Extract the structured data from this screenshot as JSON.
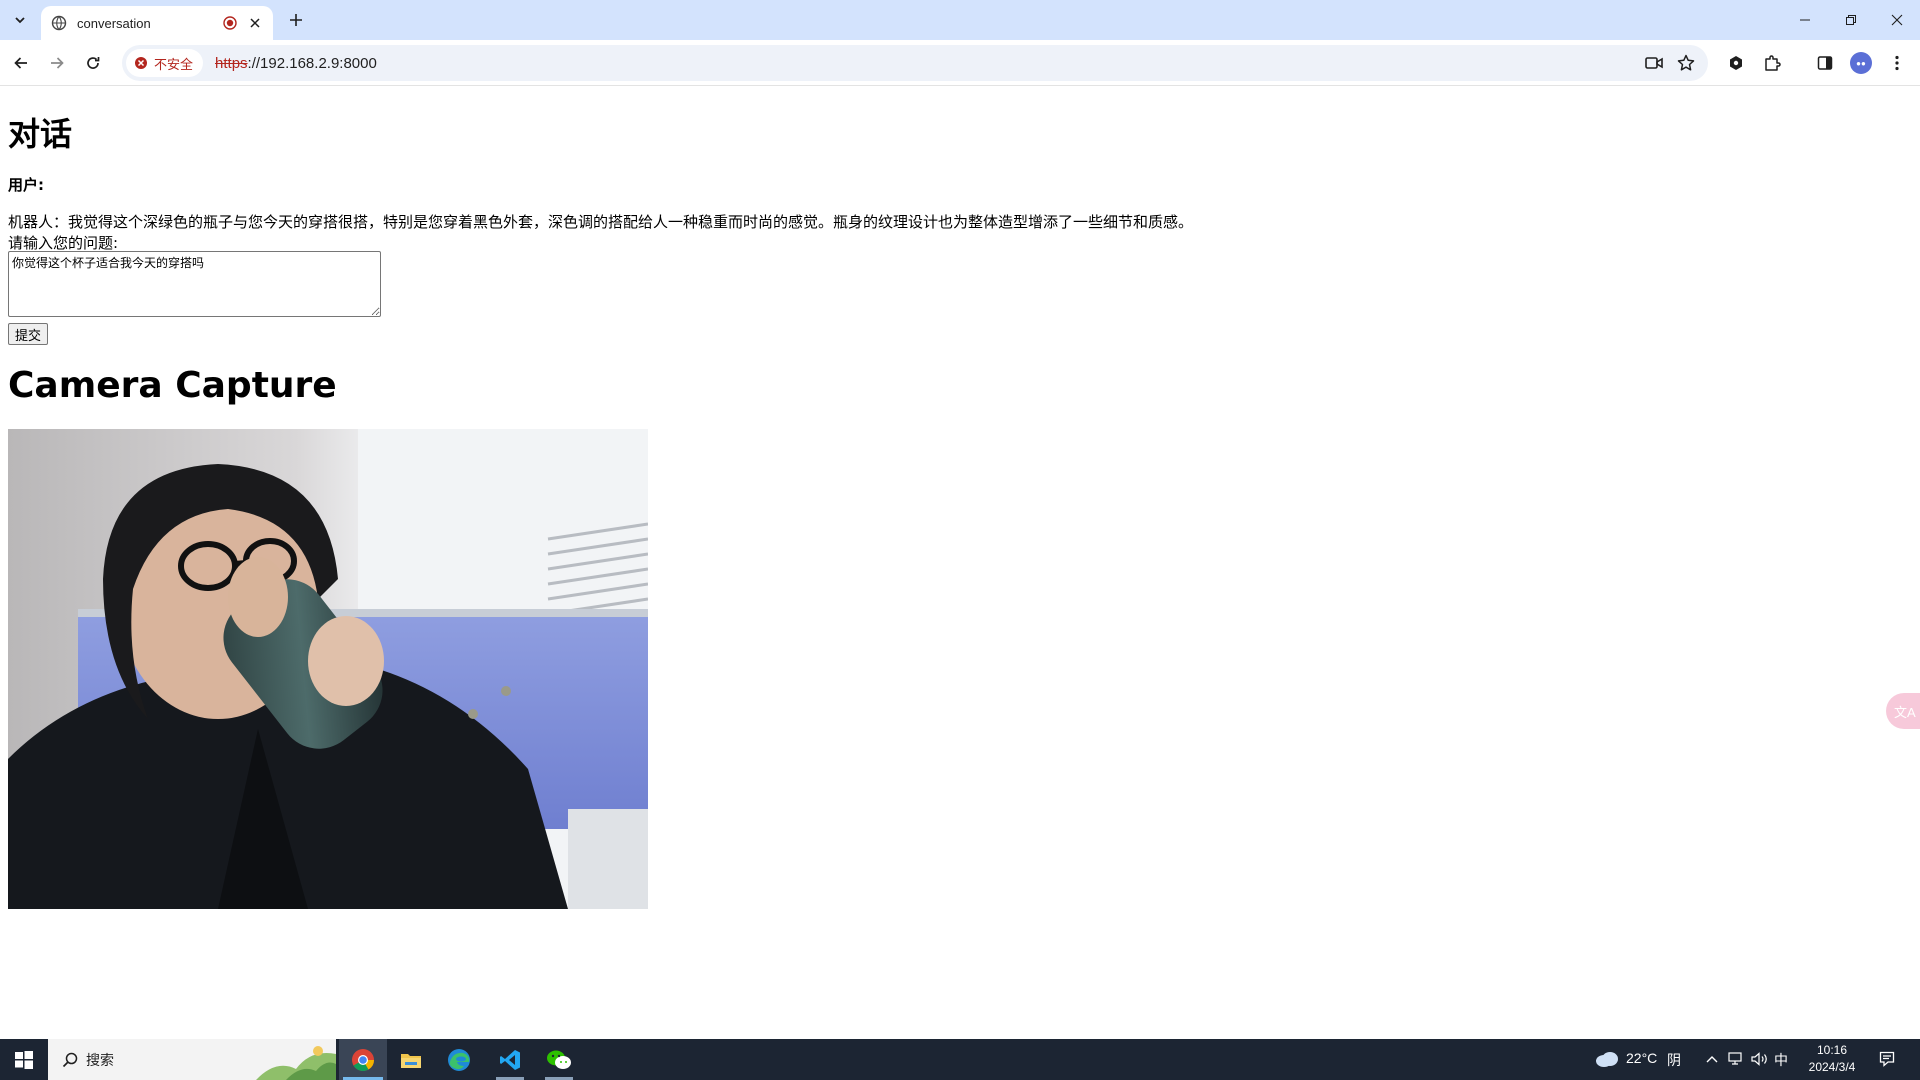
{
  "browser": {
    "tab": {
      "title": "conversation"
    },
    "address": {
      "security_label": "不安全",
      "scheme": "https",
      "rest": "://192.168.2.9:8000"
    }
  },
  "page": {
    "title": "对话",
    "user_label": "用户:",
    "bot_reply": "机器人：我觉得这个深绿色的瓶子与您今天的穿搭很搭，特别是您穿着黑色外套，深色调的搭配给人一种稳重而时尚的感觉。瓶身的纹理设计也为整体造型增添了一些细节和质感。",
    "prompt_label": "请输入您的问题:",
    "question_value": "你觉得这个杯子适合我今天的穿搭吗",
    "submit_label": "提交",
    "camera_title": "Camera Capture"
  },
  "taskbar": {
    "search_placeholder": "搜索",
    "weather_temp": "22°C",
    "weather_desc": "阴",
    "ime": "中",
    "time": "10:16",
    "date": "2024/3/4"
  },
  "colors": {
    "tabstrip": "#d3e3fd",
    "omnibox": "#eef2f9",
    "insecure_red": "#b3261e",
    "taskbar": "#1c2533",
    "accent": "#76b9ed"
  },
  "icons": {
    "tab_search": "chevron-down-icon",
    "favicon": "globe-icon",
    "recording": "recording-icon",
    "close": "close-icon",
    "new_tab": "plus-icon",
    "back": "arrow-left-icon",
    "forward": "arrow-right-icon",
    "reload": "reload-icon",
    "insecure": "warning-icon",
    "camera": "video-camera-icon",
    "bookmark": "star-icon",
    "extensions": "puzzle-icon",
    "sidepanel": "side-panel-icon",
    "menu": "kebab-menu-icon"
  }
}
